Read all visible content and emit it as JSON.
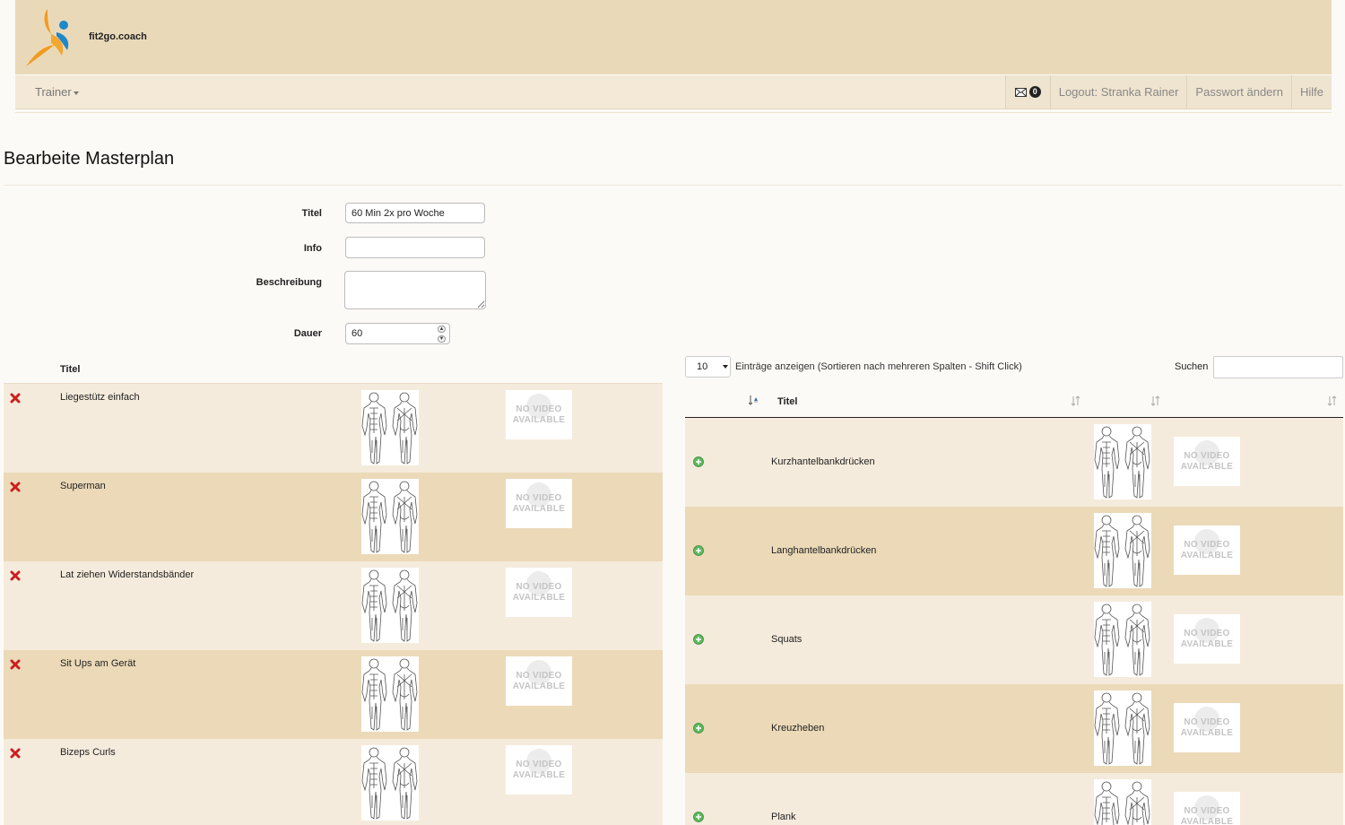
{
  "brand": {
    "name": "fit2go.coach"
  },
  "nav": {
    "menu_label": "Trainer",
    "mail_count": "0",
    "logout": "Logout: Stranka Rainer",
    "change_password": "Passwort ändern",
    "help": "Hilfe"
  },
  "page": {
    "title": "Bearbeite Masterplan"
  },
  "form": {
    "title_label": "Titel",
    "title_value": "60 Min 2x pro Woche",
    "info_label": "Info",
    "info_value": "",
    "description_label": "Beschreibung",
    "description_value": "",
    "duration_label": "Dauer",
    "duration_value": "60"
  },
  "plan_table": {
    "header_title": "Titel",
    "rows": [
      {
        "title": "Liegestütz einfach",
        "video": "NO VIDEO AVAILABLE"
      },
      {
        "title": "Superman",
        "video": "NO VIDEO AVAILABLE"
      },
      {
        "title": "Lat ziehen Widerstandsbänder",
        "video": "NO VIDEO AVAILABLE"
      },
      {
        "title": "Sit Ups am Gerät",
        "video": "NO VIDEO AVAILABLE"
      },
      {
        "title": "Bizeps Curls",
        "video": "NO VIDEO AVAILABLE"
      }
    ]
  },
  "exercise_table": {
    "length_value": "10",
    "length_text": "Einträge anzeigen (Sortieren nach mehreren Spalten - Shift Click)",
    "search_label": "Suchen",
    "search_value": "",
    "header_title": "Titel",
    "rows": [
      {
        "title": "Kurzhantelbankdrücken",
        "video": "NO VIDEO AVAILABLE"
      },
      {
        "title": "Langhantelbankdrücken",
        "video": "NO VIDEO AVAILABLE"
      },
      {
        "title": "Squats",
        "video": "NO VIDEO AVAILABLE"
      },
      {
        "title": "Kreuzheben",
        "video": "NO VIDEO AVAILABLE"
      },
      {
        "title": "Plank",
        "video": "NO VIDEO AVAILABLE"
      }
    ]
  },
  "colors": {
    "brand_bar": "#ead9b9",
    "navbar": "#f3e9d6",
    "row_light": "#f5ebdc",
    "row_dark": "#ebd9b8",
    "delete_icon": "#cc1f1f",
    "add_icon": "#5cb85c"
  },
  "icons": {
    "logo": "fit2go-logo",
    "mail": "envelope-icon",
    "delete": "delete-x-icon",
    "add": "add-circle-icon",
    "sort": "sort-icon",
    "muscle_chart": "muscle-chart-image"
  }
}
